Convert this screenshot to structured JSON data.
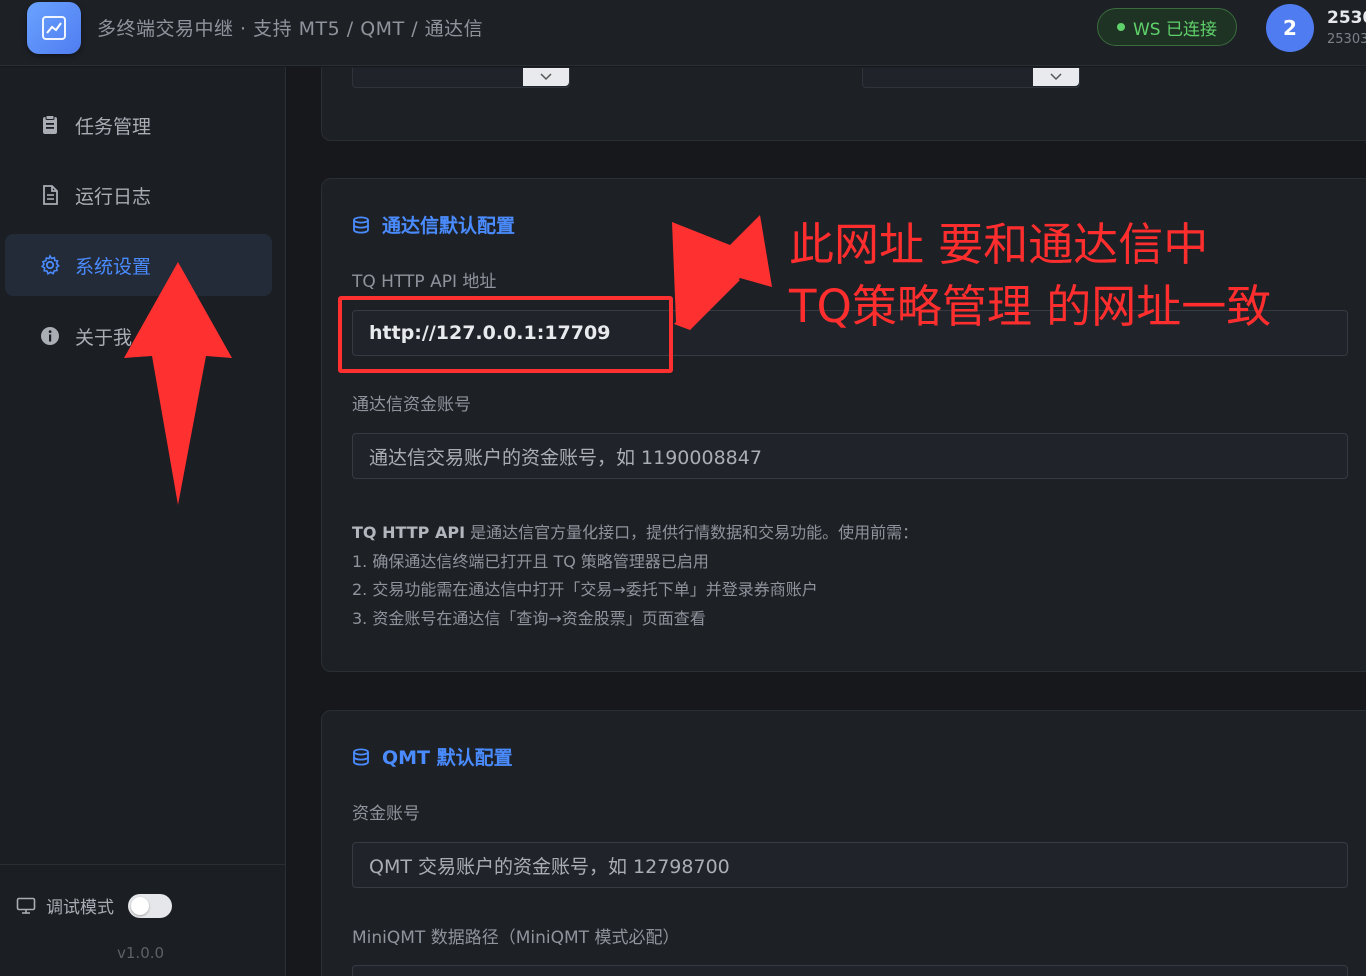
{
  "header": {
    "title": "多终端交易中继 · 支持 MT5 / QMT / 通达信",
    "ws_status": "WS 已连接",
    "avatar_text": "2",
    "user_name": "2530",
    "user_id": "25303",
    "logo_icon": "chart-line-icon"
  },
  "sidebar": {
    "items": [
      {
        "label": "任务管理",
        "icon": "clipboard-icon",
        "active": false
      },
      {
        "label": "运行日志",
        "icon": "document-icon",
        "active": false
      },
      {
        "label": "系统设置",
        "icon": "gear-icon",
        "active": true
      },
      {
        "label": "关于我",
        "icon": "info-icon",
        "active": false
      }
    ],
    "debug_label": "调试模式",
    "debug_enabled": false,
    "version": "v1.0.0"
  },
  "tdx": {
    "heading": "通达信默认配置",
    "url_label": "TQ HTTP API 地址",
    "url_value": "http://127.0.0.1:17709",
    "account_label": "通达信资金账号",
    "account_placeholder": "通达信交易账户的资金账号，如 1190008847",
    "help_strong": "TQ HTTP API",
    "help_intro": " 是通达信官方量化接口，提供行情数据和交易功能。使用前需：",
    "help_lines": [
      "1. 确保通达信终端已打开且 TQ 策略管理器已启用",
      "2. 交易功能需在通达信中打开「交易→委托下单」并登录券商账户",
      "3. 资金账号在通达信「查询→资金股票」页面查看"
    ]
  },
  "qmt": {
    "heading": "QMT 默认配置",
    "account_label": "资金账号",
    "account_placeholder": "QMT 交易账户的资金账号，如 12798700",
    "path_label": "MiniQMT 数据路径（MiniQMT 模式必配）"
  },
  "annotation": {
    "line1": "此网址 要和通达信中",
    "line2": "TQ策略管理 的网址一致",
    "color": "#ff2e2e"
  },
  "colors": {
    "accent": "#4a8cff",
    "success": "#5fd16b",
    "background": "#16181c",
    "card": "#1d2025"
  }
}
